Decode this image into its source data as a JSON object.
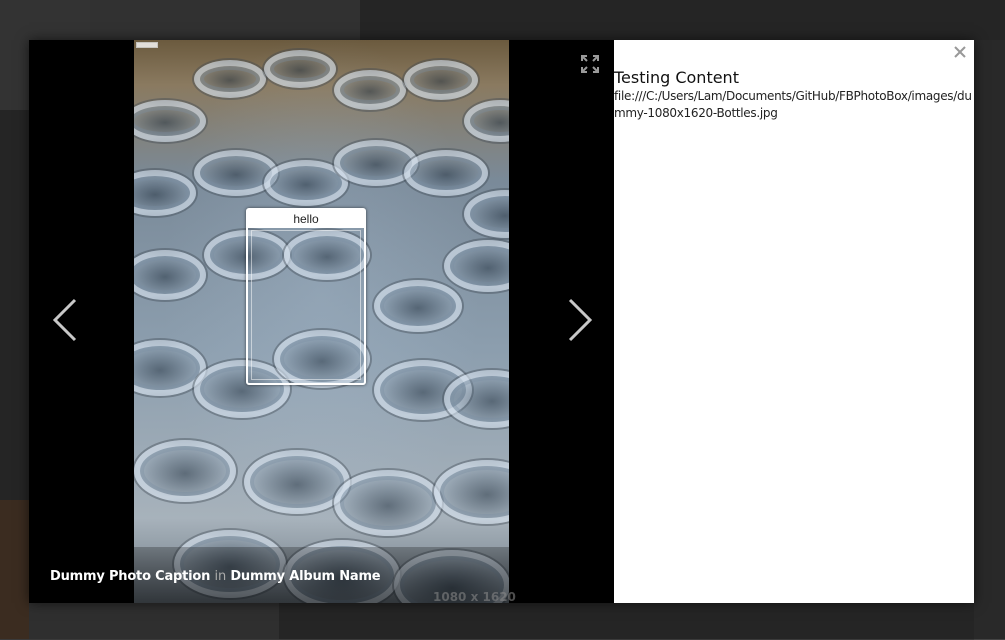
{
  "lightbox": {
    "tag_label": "hello",
    "caption": {
      "photo": "Dummy Photo Caption",
      "in_word": "in",
      "album": "Dummy Album Name"
    },
    "dimensions": "1080 x 1620"
  },
  "side_panel": {
    "title": "Testing Content",
    "path": "file:///C:/Users/Lam/Documents/GitHub/FBPhotoBox/images/dummy-1080x1620-Bottles.jpg"
  },
  "icons": {
    "prev": "chevron-left-icon",
    "next": "chevron-right-icon",
    "fullscreen": "expand-icon",
    "close": "close-icon"
  },
  "colors": {
    "backdrop": "#3a3a3a",
    "stage": "#000000",
    "panel": "#ffffff",
    "nav_arrow": "#c8c8c8"
  }
}
